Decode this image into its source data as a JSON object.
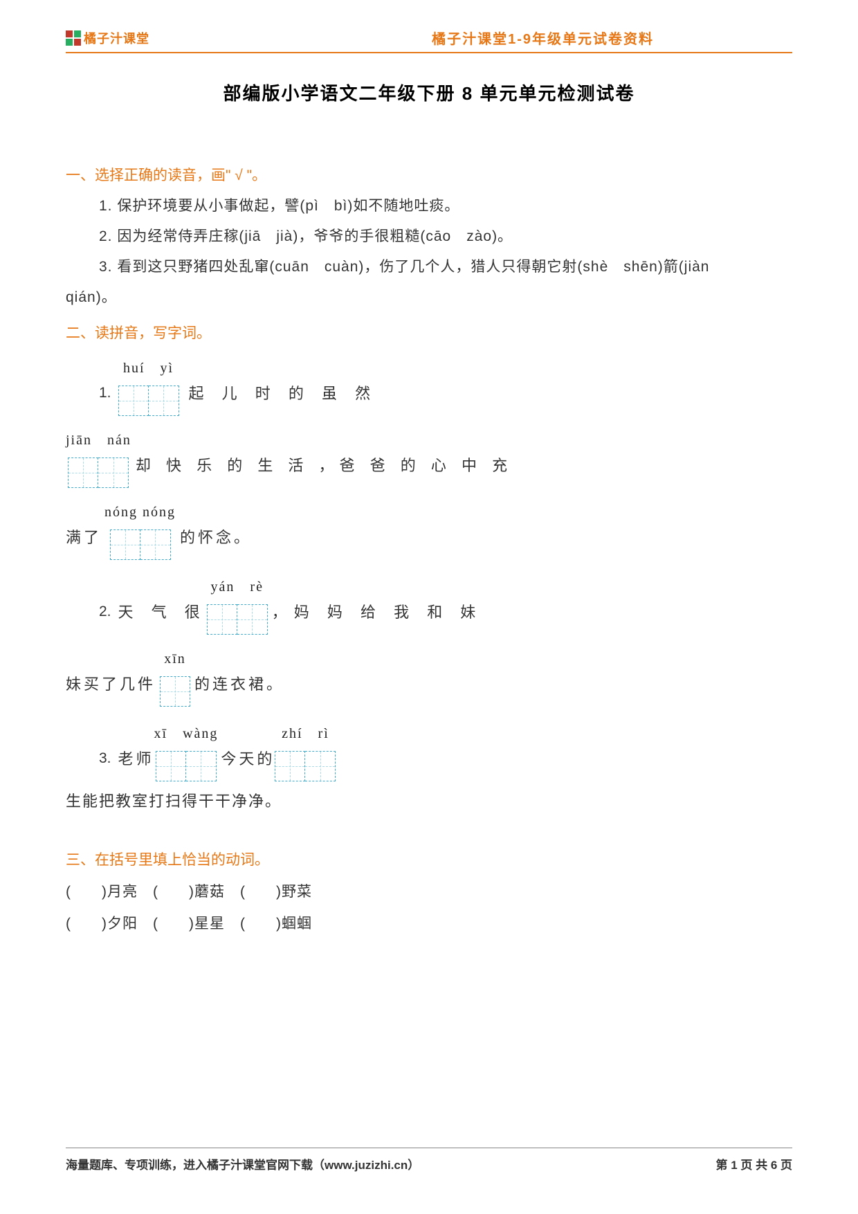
{
  "header": {
    "logo_text": "橘子汁课堂",
    "right_text": "橘子汁课堂1-9年级单元试卷资料"
  },
  "title": "部编版小学语文二年级下册 8 单元单元检测试卷",
  "section1": {
    "heading": "一、选择正确的读音，画\" √ \"。",
    "q1": "1. 保护环境要从小事做起，譬(pì　bì)如不随地吐痰。",
    "q2": "2. 因为经常侍弄庄稼(jiā　jià)，爷爷的手很粗糙(cāo　zào)。",
    "q3_a": "3. 看到这只野猪四处乱窜(cuān　cuàn)，伤了几个人，猎人只得朝它射(shè　shēn)箭(jiàn",
    "q3_b": "qián)。"
  },
  "section2": {
    "heading": "二、读拼音，写字词。",
    "q1": {
      "num": "1.",
      "py1": "huí　yì",
      "t1": "起 儿 时 的 虽 然",
      "py2": "jiān　nán",
      "t2": "却 快 乐 的 生 活 ，爸 爸 的 心 中 充",
      "py3": "nóng nóng",
      "t3a": "满了",
      "t3b": "的怀念。"
    },
    "q2": {
      "num": "2.",
      "t1a": "天 气 很",
      "py1": "yán　rè",
      "t1b": "，妈 妈 给 我 和 妹",
      "t2a": "妹买了几件",
      "py2": "xīn",
      "t2b": "的连衣裙。"
    },
    "q3": {
      "num": "3.",
      "t1a": "老师",
      "py1": "xī　wàng",
      "t1b": "今天的",
      "py2": "zhí　rì",
      "bottom": "生能把教室打扫得干干净净。"
    }
  },
  "section3": {
    "heading": "三、在括号里填上恰当的动词。",
    "row1": "(　　)月亮　(　　)蘑菇　(　　)野菜",
    "row2": "(　　)夕阳　(　　)星星　(　　)蝈蝈"
  },
  "footer": {
    "left": "海量题库、专项训练，进入橘子汁课堂官网下载（www.juzizhi.cn）",
    "right": "第 1 页 共 6 页"
  }
}
